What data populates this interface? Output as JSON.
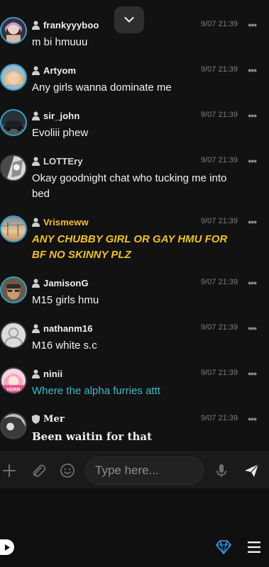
{
  "messages": [
    {
      "user": "frankyyyboo",
      "time": "9/07 21:39",
      "text": "m bi hmuuu",
      "style": "normal",
      "avatar": "anime-girl-avatar"
    },
    {
      "user": "Artyom",
      "time": "9/07 21:39",
      "text": "Any girls wanna dominate me",
      "style": "normal",
      "avatar": "blonde-person-avatar"
    },
    {
      "user": "sir_john",
      "time": "9/07 21:39",
      "text": "Evoliii phew",
      "style": "normal",
      "avatar": "car-avatar"
    },
    {
      "user": "LOTTEry",
      "time": "9/07 21:39",
      "text": "Okay goodnight chat who tucking me into bed",
      "style": "normal",
      "avatar": "anime-character-avatar"
    },
    {
      "user": "Vrismeww",
      "time": "9/07 21:39",
      "text": "ANY CHUBBY GIRL OR GAY HMU FOR BF NO SKINNY PLZ",
      "style": "gold",
      "avatar": "sunset-sky-avatar"
    },
    {
      "user": "JamisonG",
      "time": "9/07 21:39",
      "text": "M15 girls hmu",
      "style": "normal",
      "avatar": "selfie-avatar"
    },
    {
      "user": "nathanm16",
      "time": "9/07 21:39",
      "text": "M16 white s.c",
      "style": "normal",
      "avatar": "default-user-avatar"
    },
    {
      "user": "ninii",
      "time": "9/07 21:39",
      "text": "Where the alpha furries attt",
      "style": "teal",
      "avatar": "pink-anime-avatar",
      "avatar_caption": "HORN"
    },
    {
      "user": "Mer",
      "time": "9/07 21:39",
      "text": "Been waitin for that",
      "style": "serif",
      "avatar": "monochrome-avatar"
    }
  ],
  "more_glyph": "•••",
  "composer": {
    "placeholder": "Type here...",
    "icons": [
      "plus-icon",
      "paperclip-icon",
      "emoji-icon",
      "microphone-icon",
      "send-icon"
    ]
  },
  "bottom_bar": {
    "icons": [
      "play-icon",
      "diamond-icon",
      "menu-icon"
    ]
  },
  "colors": {
    "background": "#121212",
    "accent_teal": "#3fb8c9",
    "highlight_gold": "#f2c12e",
    "avatar_ring": "#35a3c9",
    "diamond": "#2f8fd6"
  }
}
